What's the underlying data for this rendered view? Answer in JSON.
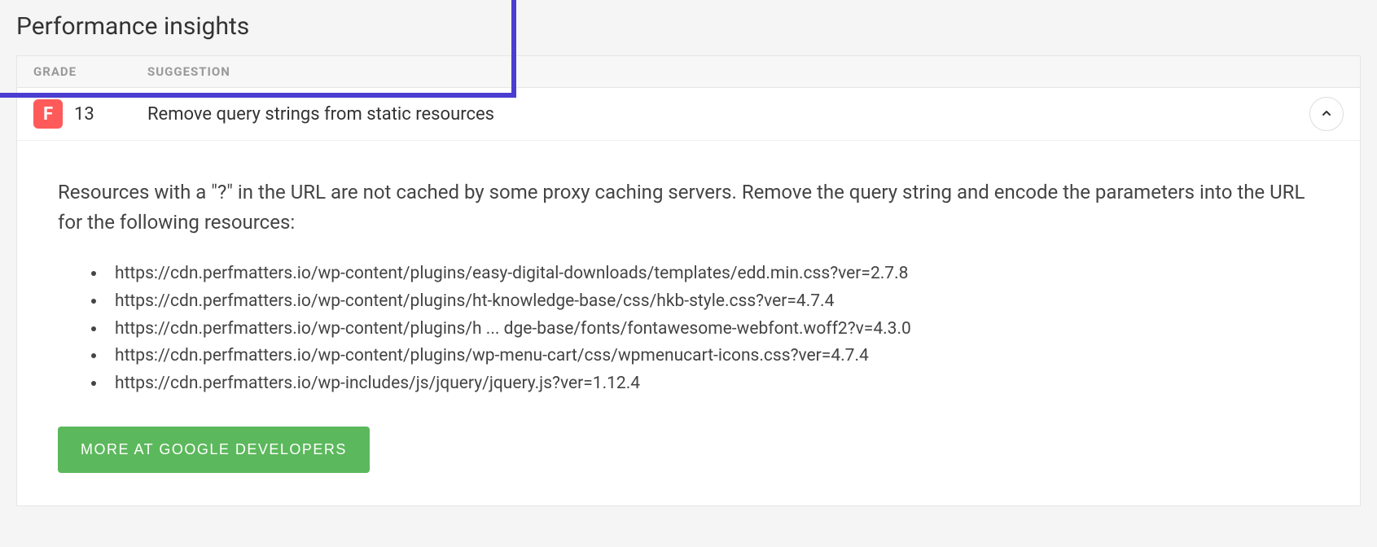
{
  "title": "Performance insights",
  "headers": {
    "grade": "GRADE",
    "suggestion": "SUGGESTION"
  },
  "item": {
    "grade_letter": "F",
    "grade_score": "13",
    "suggestion": "Remove query strings from static resources"
  },
  "body": {
    "description": "Resources with a \"?\" in the URL are not cached by some proxy caching servers. Remove the query string and encode the parameters into the URL for the following resources:",
    "resources": [
      "https://cdn.perfmatters.io/wp-content/plugins/easy-digital-downloads/templates/edd.min.css?ver=2.7.8",
      "https://cdn.perfmatters.io/wp-content/plugins/ht-knowledge-base/css/hkb-style.css?ver=4.7.4",
      "https://cdn.perfmatters.io/wp-content/plugins/h ... dge-base/fonts/fontawesome-webfont.woff2?v=4.3.0",
      "https://cdn.perfmatters.io/wp-content/plugins/wp-menu-cart/css/wpmenucart-icons.css?ver=4.7.4",
      "https://cdn.perfmatters.io/wp-includes/js/jquery/jquery.js?ver=1.12.4"
    ],
    "button": "MORE AT GOOGLE DEVELOPERS"
  }
}
